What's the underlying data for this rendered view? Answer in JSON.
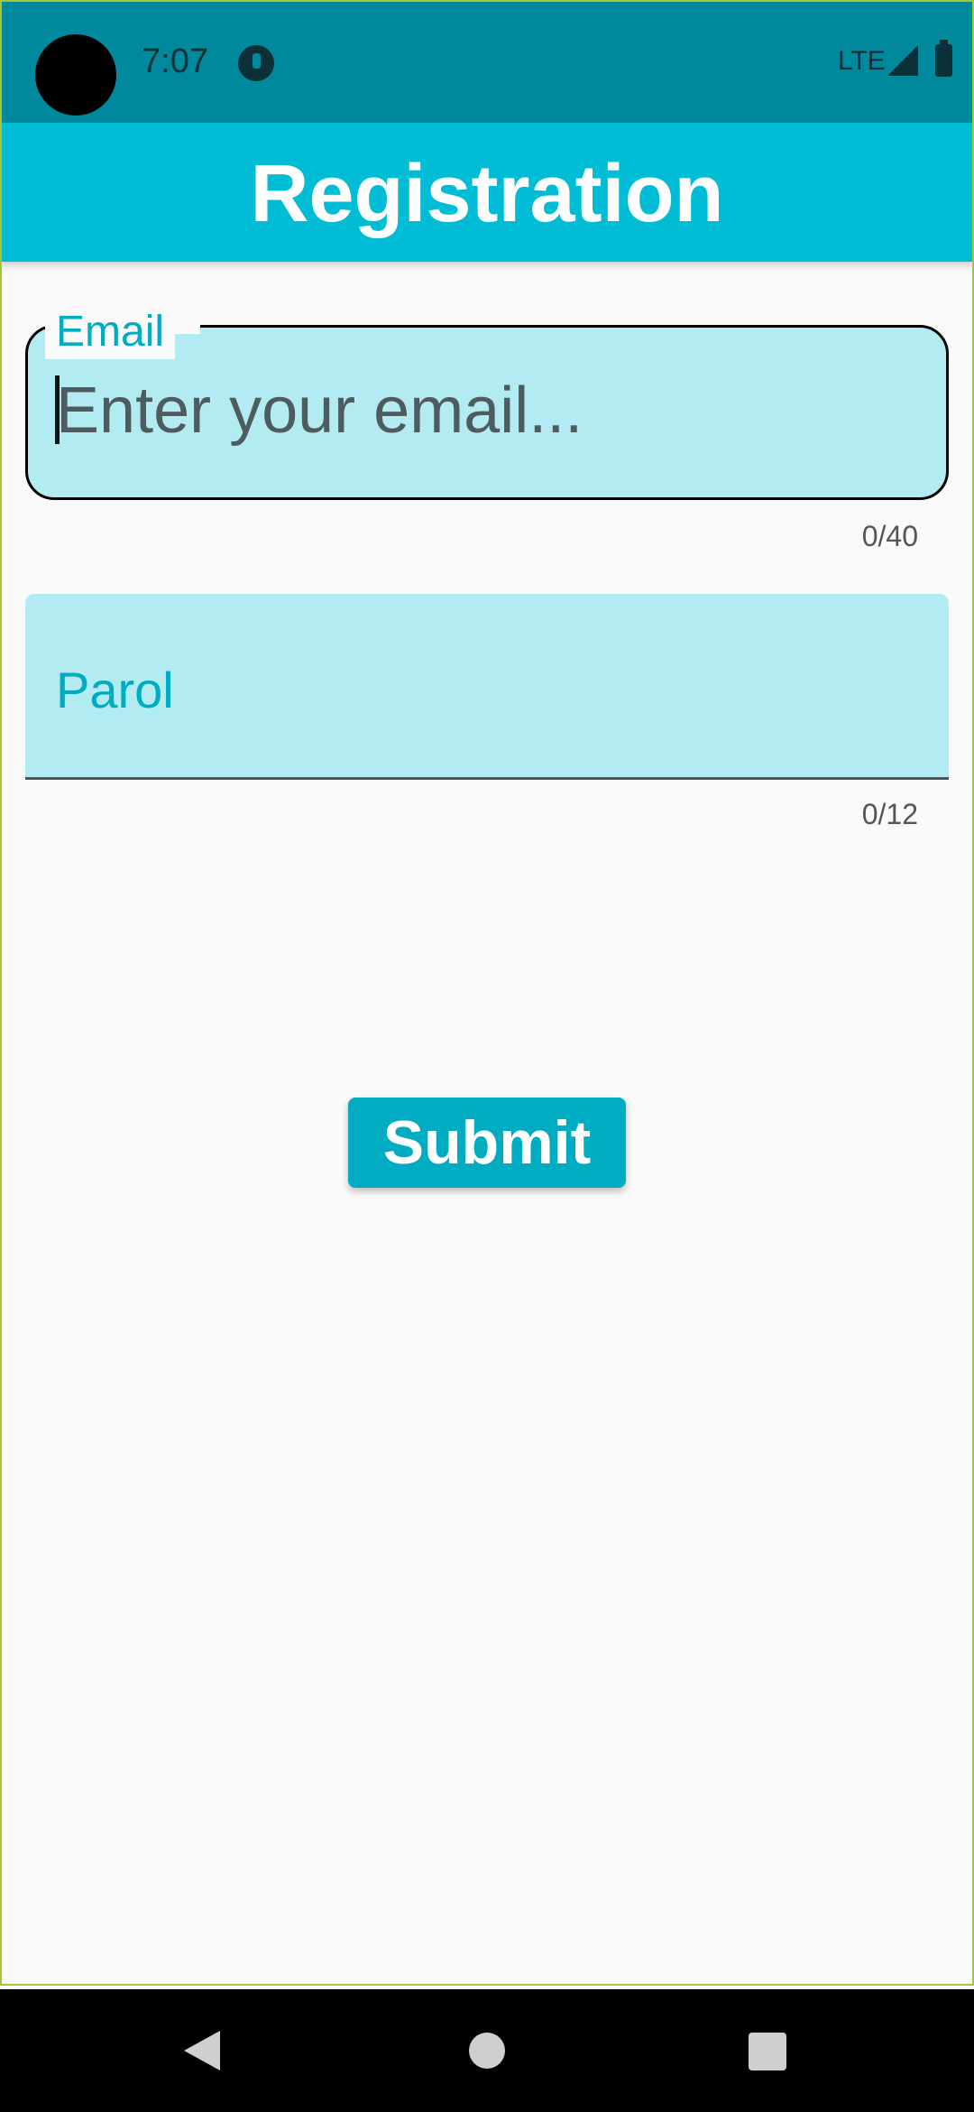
{
  "status_bar": {
    "time": "7:07",
    "network": "LTE",
    "icons": [
      "camera-cutout",
      "notification-icon",
      "signal-icon",
      "battery-icon"
    ]
  },
  "app_bar": {
    "title": "Registration"
  },
  "email": {
    "label": "Email",
    "placeholder": "Enter your email...",
    "value": "",
    "counter": "0/40"
  },
  "parol": {
    "label": "Parol",
    "value": "",
    "counter": "0/12"
  },
  "submit": {
    "label": "Submit"
  },
  "nav": {
    "icons": [
      "back-icon",
      "home-icon",
      "recents-icon"
    ]
  },
  "colors": {
    "status_bar": "#00899c",
    "app_bar": "#00bcd4",
    "field_fill": "#b2ebf2",
    "accent": "#00acc1",
    "background": "#fafafa",
    "frame": "#a4c639"
  }
}
